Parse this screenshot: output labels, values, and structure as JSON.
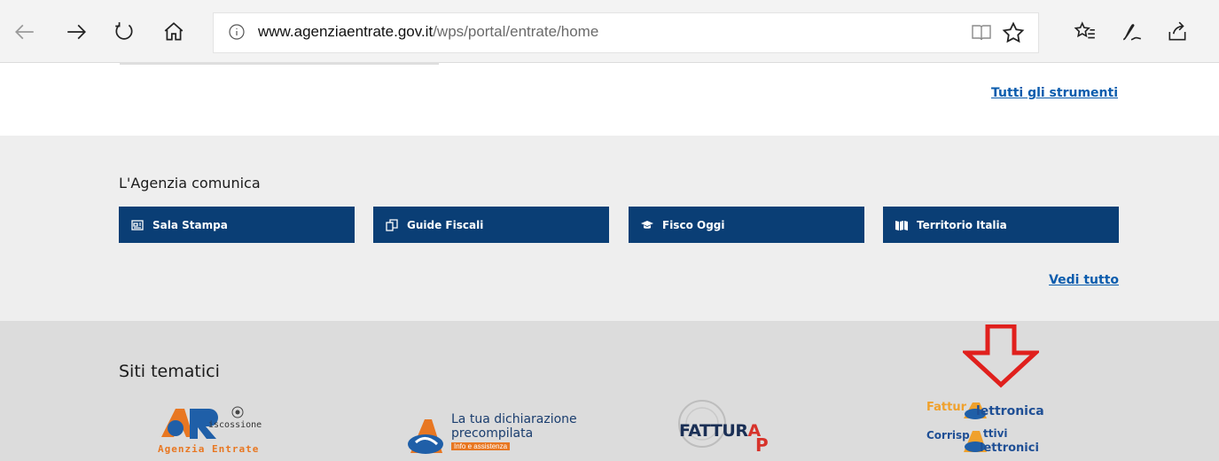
{
  "browser": {
    "url_domain": "www.agenziaentrate.gov.it",
    "url_path": "/wps/portal/entrate/home",
    "icons": [
      "back-arrow-icon",
      "forward-arrow-icon",
      "refresh-icon",
      "home-icon",
      "info-icon",
      "reading-view-icon",
      "favorite-star-icon",
      "favorites-list-icon",
      "pen-icon",
      "share-icon"
    ]
  },
  "tools_link": "Tutti gli strumenti",
  "comunica": {
    "heading": "L'Agenzia comunica",
    "buttons": [
      {
        "label": "Sala Stampa",
        "icon": "newspaper-icon"
      },
      {
        "label": "Guide Fiscali",
        "icon": "copy-docs-icon"
      },
      {
        "label": "Fisco Oggi",
        "icon": "graduation-cap-icon"
      },
      {
        "label": "Territorio Italia",
        "icon": "map-icon"
      }
    ],
    "see_all": "Vedi tutto"
  },
  "tematici": {
    "heading": "Siti tematici",
    "riscossione": {
      "line1": "iscossione",
      "line2": "Agenzia Entrate"
    },
    "precompilata": {
      "line1": "La tua dichiarazione",
      "line2": "precompilata",
      "line3": "Info e assistenza"
    },
    "fatturapa": {
      "text1": "FATTUR",
      "text2": "A",
      "text3": "P"
    },
    "fattura_el": {
      "a": "Fattur",
      "b": "lettronica",
      "c": "Corrisp",
      "d": "ttivi",
      "e": "lettronici"
    }
  },
  "colors": {
    "accent": "#0a3e75",
    "link": "#0b5cad",
    "arrow": "#e0201d"
  }
}
